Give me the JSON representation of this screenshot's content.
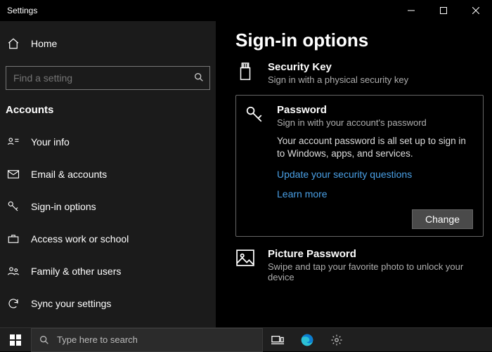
{
  "titlebar": {
    "title": "Settings"
  },
  "sidebar": {
    "home_label": "Home",
    "search_placeholder": "Find a setting",
    "category": "Accounts",
    "items": [
      {
        "label": "Your info"
      },
      {
        "label": "Email & accounts"
      },
      {
        "label": "Sign-in options"
      },
      {
        "label": "Access work or school"
      },
      {
        "label": "Family & other users"
      },
      {
        "label": "Sync your settings"
      }
    ]
  },
  "main": {
    "title": "Sign-in options",
    "security_key": {
      "title": "Security Key",
      "desc": "Sign in with a physical security key"
    },
    "password": {
      "title": "Password",
      "desc": "Sign in with your account's password",
      "status": "Your account password is all set up to sign in to Windows, apps, and services.",
      "link_update": "Update your security questions",
      "link_learn": "Learn more",
      "change_btn": "Change"
    },
    "picture": {
      "title": "Picture Password",
      "desc": "Swipe and tap your favorite photo to unlock your device"
    }
  },
  "taskbar": {
    "search_placeholder": "Type here to search"
  }
}
